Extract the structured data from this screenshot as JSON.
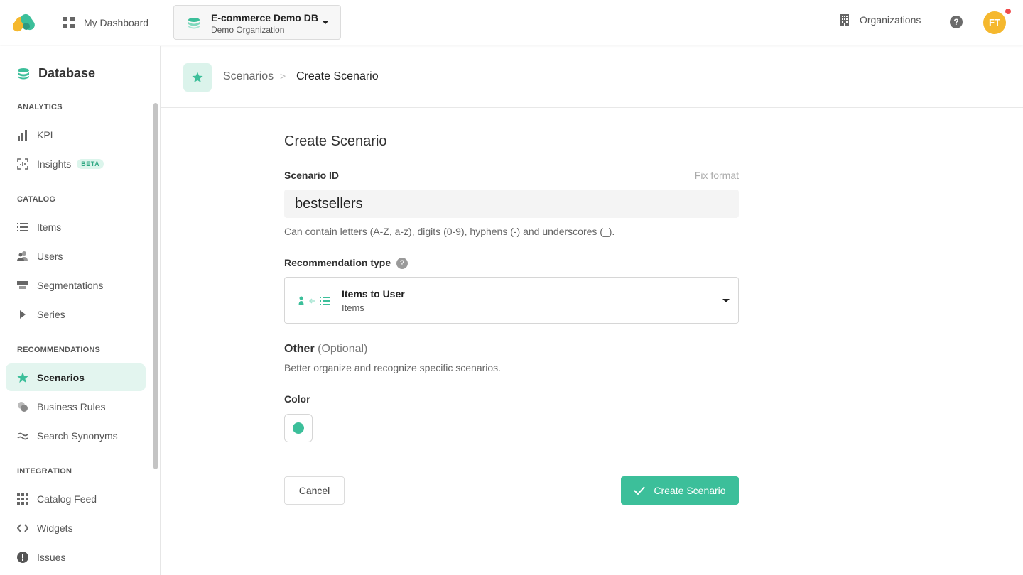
{
  "colors": {
    "accent": "#3cbf9a",
    "accent_light": "#e3f5ef",
    "avatar": "#f5b82e",
    "notification": "#ef4b4b"
  },
  "topbar": {
    "logo_icon": "app-logo-icon",
    "dashboard_label": "My Dashboard",
    "database": {
      "name": "E-commerce Demo DB",
      "organization": "Demo Organization"
    },
    "organizations_label": "Organizations",
    "help_symbol": "?",
    "avatar_initials": "FT"
  },
  "sidebar": {
    "title": "Database",
    "sections": {
      "analytics": "ANALYTICS",
      "catalog": "CATALOG",
      "recommendations": "RECOMMENDATIONS",
      "integration": "INTEGRATION"
    },
    "items": {
      "kpi": "KPI",
      "insights": "Insights",
      "insights_badge": "BETA",
      "items": "Items",
      "users": "Users",
      "segmentations": "Segmentations",
      "series": "Series",
      "scenarios": "Scenarios",
      "business_rules": "Business Rules",
      "search_synonyms": "Search Synonyms",
      "catalog_feed": "Catalog Feed",
      "widgets": "Widgets",
      "issues": "Issues"
    }
  },
  "breadcrumb": {
    "parent": "Scenarios",
    "separator": ">",
    "current": "Create Scenario"
  },
  "form": {
    "title": "Create Scenario",
    "scenario_id_label": "Scenario ID",
    "fix_format_label": "Fix format",
    "scenario_id_value": "bestsellers",
    "scenario_id_hint": "Can contain letters (A-Z, a-z), digits (0-9), hyphens (-) and underscores (_).",
    "rec_type_label": "Recommendation type",
    "rec_type_help": "?",
    "rec_type_title": "Items to User",
    "rec_type_subtitle": "Items",
    "other_label": "Other",
    "other_optional": "(Optional)",
    "other_hint": "Better organize and recognize specific scenarios.",
    "color_label": "Color",
    "color_value": "#3cbf9a",
    "cancel_label": "Cancel",
    "create_label": "Create Scenario"
  }
}
